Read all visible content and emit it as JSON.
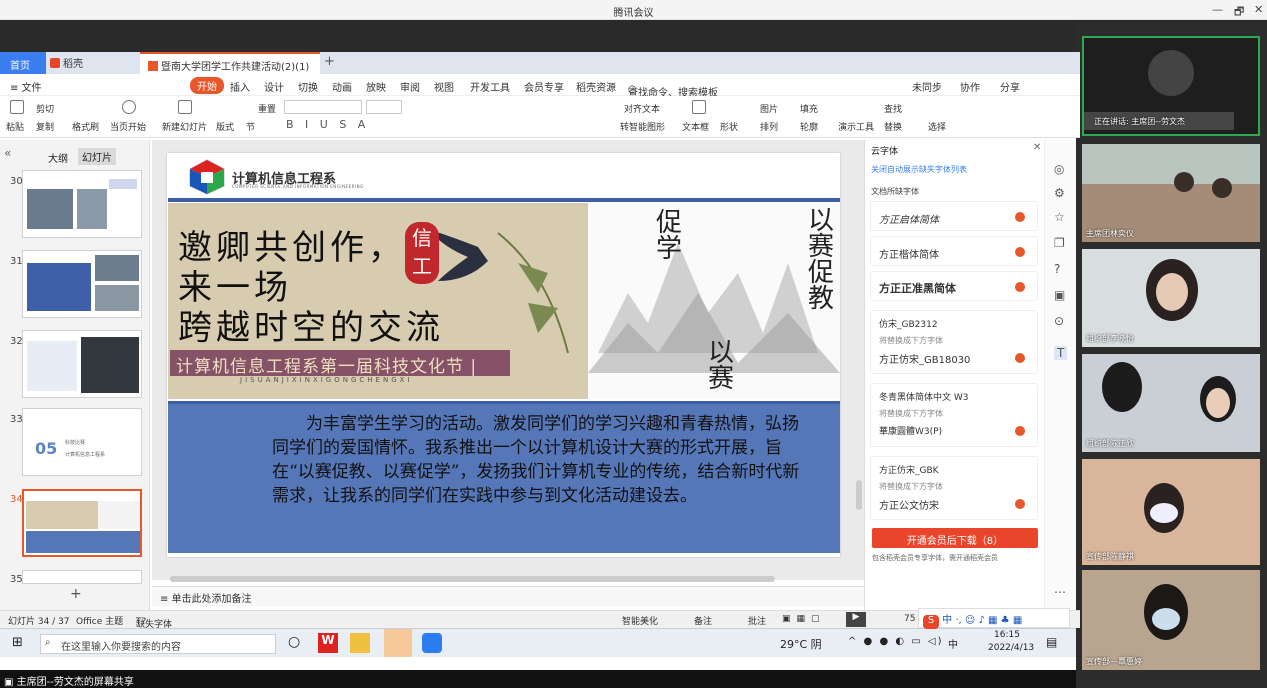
{
  "window": {
    "title": "腾讯会议",
    "minimize": "—",
    "restore": "🗗",
    "close": "✕"
  },
  "tabs": {
    "home": "首页",
    "dk": "稻壳",
    "doc": "暨南大学团学工作共建活动(2)(1)",
    "add": "+"
  },
  "menu": {
    "file": "≡ 文件",
    "start": "开始",
    "insert": "插入",
    "design": "设计",
    "transition": "切换",
    "animation": "动画",
    "slideshow": "放映",
    "review": "审阅",
    "view": "视图",
    "dev": "开发工具",
    "vip": "会员专享",
    "dkres": "稻壳资源",
    "search": "查找命令、搜索模板",
    "sync": "未同步",
    "collab": "协作",
    "share": "分享"
  },
  "ribbon": {
    "paste": "粘贴",
    "cut": "剪切",
    "copy": "复制",
    "format": "格式刷",
    "fromstart": "当页开始",
    "newslide": "新建幻灯片",
    "layout": "版式",
    "section": "节",
    "reset": "重置",
    "textbox": "文本框",
    "shape": "形状",
    "picture": "图片",
    "fill": "填充",
    "arrange": "排列",
    "outline": "轮廓",
    "tools": "演示工具",
    "find": "查找",
    "replace": "替换",
    "select": "选择",
    "align": "对齐文本",
    "smartart": "转智能图形"
  },
  "leftpane": {
    "outline": "大纲",
    "slides": "幻灯片",
    "nums": [
      "30",
      "31",
      "32",
      "33",
      "34",
      "35"
    ],
    "thumb33_num": "05",
    "thumb33_a": "科技比赛",
    "thumb33_b": "计算机信息工程系"
  },
  "slide": {
    "logo": "计算机信息工程系",
    "logo_en": "COMPUTER SCIENCE AND INFORMATION ENGINEERING",
    "line1": "邀卿共创作，",
    "line2": "来一场",
    "line3": "跨越时空的交流",
    "seal": "信工",
    "subtitle": "计算机信息工程系第一届科技文化节 |",
    "pinyin": "JISUANJIXINXIGONGCHENGXI",
    "r1": "促学",
    "r2": "以赛促教",
    "r3": "以赛",
    "body": "　　为丰富学生学习的活动。激发同学们的学习兴趣和青春热情，弘扬同学们的爱国情怀。我系推出一个以计算机设计大赛的形式开展，旨在“以赛促教、以赛促学”，发扬我们计算机专业的传统，结合新时代新需求，让我系的同学们在实践中参与到文化活动建设去。"
  },
  "cloud": {
    "header": "云字体",
    "hide_link": "关闭自动展示缺失字体列表",
    "missing_title": "文档所缺字体",
    "fonts": [
      {
        "name": "方正启体简体"
      },
      {
        "name": "方正楷体简体"
      },
      {
        "name": "方正正准黑简体"
      },
      {
        "name": "仿宋_GB2312",
        "sub": "将替换成下方字体",
        "alt": "方正仿宋_GB18030"
      },
      {
        "name": "冬青黑体简体中文 W3",
        "sub": "将替换成下方字体",
        "alt": "華康圓體W3(P)"
      },
      {
        "name": "方正仿宋_GBK",
        "sub": "将替换成下方字体",
        "alt": "方正公文仿宋"
      }
    ],
    "button": "开通会员后下载（8）",
    "note": "包含稻壳会员专享字体，需开通稻壳会员"
  },
  "notes": "单击此处添加备注",
  "status": {
    "slide": "幻灯片 34 / 37",
    "theme": "Office 主题",
    "missing": "缺失字体",
    "beautify": "智能美化",
    "notes": "备注",
    "comment": "批注",
    "zoom": "75"
  },
  "taskbar": {
    "search": "在这里输入你要搜索的内容",
    "weather": "29°C 阴",
    "time": "16:15",
    "date": "2022/4/13",
    "ime": "中"
  },
  "sharebar": "主席团--劳文杰的屏幕共享",
  "participants": [
    {
      "label": "正在讲话: 主席团--劳文杰"
    },
    {
      "label": "主席团林奕仪"
    },
    {
      "label": "组织部李晓怡"
    },
    {
      "label": "组织部陈正欣"
    },
    {
      "label": "宣传部陈静祺"
    },
    {
      "label": "宣传部—覃惠婷"
    }
  ],
  "colors": {
    "accent": "#e8572a",
    "blue": "#5577b8",
    "wpsblue": "#3a7ef0"
  }
}
